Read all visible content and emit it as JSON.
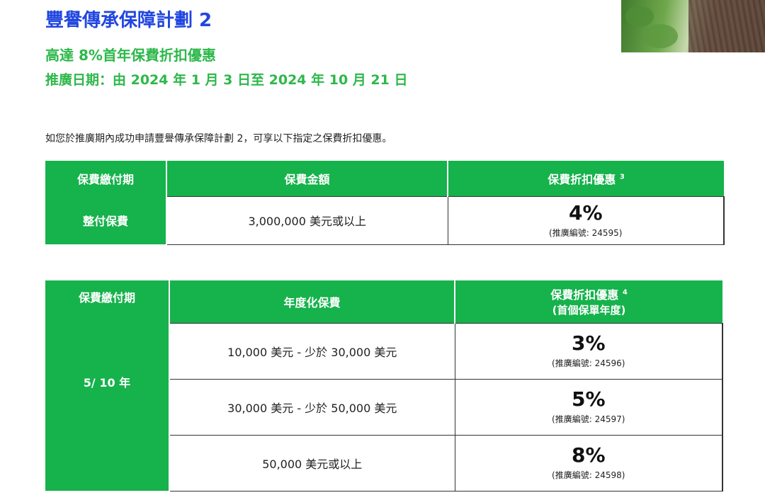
{
  "header": {
    "title": "豐譽傳承保障計劃 2",
    "offer": "高達 8%首年保費折扣優惠",
    "period": "推廣日期：由 2024 年 1 月 3 日至 2024 年 10 月 21 日"
  },
  "intro": "如您於推廣期內成功申請豐譽傳承保障計劃 2，可享以下指定之保費折扣優惠。",
  "table1": {
    "headers": {
      "period": "保費繳付期",
      "amount": "保費金額",
      "discount": "保費折扣優惠",
      "discount_note": "3"
    },
    "row": {
      "period": "整付保費",
      "amount": "3,000,000 美元或以上",
      "discount": "4%",
      "promo": "(推廣編號: 24595)"
    }
  },
  "table2": {
    "headers": {
      "period": "保費繳付期",
      "amount": "年度化保費",
      "discount": "保費折扣優惠",
      "discount_note": "4",
      "discount_sub": "(首個保單年度)"
    },
    "period": "5/ 10 年",
    "rows": [
      {
        "amount": "10,000 美元 - 少於 30,000 美元",
        "discount": "3%",
        "promo": "(推廣編號: 24596)"
      },
      {
        "amount": "30,000 美元 - 少於 50,000 美元",
        "discount": "5%",
        "promo": "(推廣編號: 24597)"
      },
      {
        "amount": "50,000 美元或以上",
        "discount": "8%",
        "promo": "(推廣編號: 24598)"
      }
    ]
  }
}
